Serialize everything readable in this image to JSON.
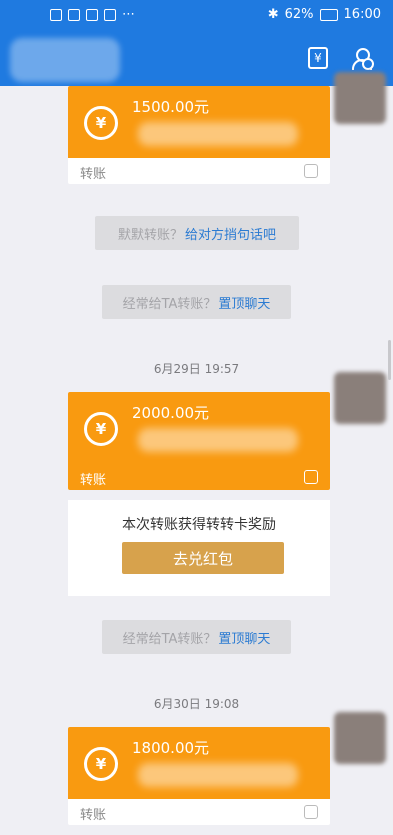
{
  "status_bar": {
    "battery": "62%",
    "time": "16:00"
  },
  "app_bar": {
    "transfer_icon": "yuan-box-icon",
    "contact_icon": "person-settings-icon"
  },
  "messages": [
    {
      "amount": "1500.00元",
      "label": "转账"
    },
    {
      "amount": "2000.00元",
      "label": "转账"
    },
    {
      "amount": "1800.00元",
      "label": "转账"
    }
  ],
  "tips": [
    {
      "text": "默默转账？",
      "link": "给对方捎句话吧"
    },
    {
      "text": "经常给TA转账？",
      "link": "置顶聊天"
    },
    {
      "text": "经常给TA转账？",
      "link": "置顶聊天"
    }
  ],
  "times": [
    "6月29日 19:57",
    "6月30日 19:08"
  ],
  "reward": {
    "text": "本次转账获得转转卡奖励",
    "button": "去兑红包"
  },
  "colors": {
    "brand_blue": "#1f7ae0",
    "transfer_orange": "#f99a10",
    "link_blue": "#2b7bd2",
    "reward_gold": "#d7a24c"
  }
}
